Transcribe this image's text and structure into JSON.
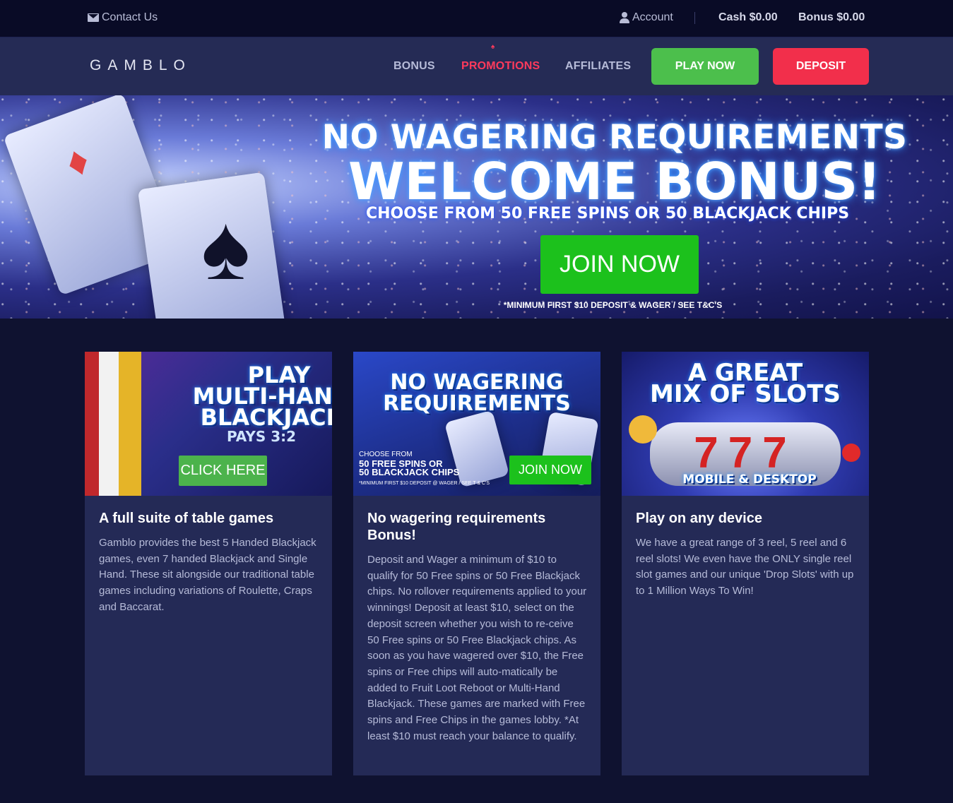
{
  "topbar": {
    "contact": "Contact Us",
    "account": "Account",
    "cash": "Cash $0.00",
    "bonus": "Bonus $0.00"
  },
  "header": {
    "logo": "GAMBLO",
    "nav": [
      "BONUS",
      "PROMOTIONS",
      "AFFILIATES"
    ],
    "active_nav": "PROMOTIONS",
    "play_now": "PLAY NOW",
    "deposit": "DEPOSIT"
  },
  "hero": {
    "line1": "NO WAGERING REQUIREMENTS",
    "line2": "WELCOME BONUS!",
    "line3": "CHOOSE FROM 50 FREE SPINS OR 50 BLACKJACK CHIPS",
    "button": "JOIN NOW",
    "terms": "*MINIMUM FIRST $10 DEPOSIT & WAGER / SEE T&C'S"
  },
  "cards": [
    {
      "img_line1": "PLAY",
      "img_line2": "MULTI-HAND",
      "img_line3": "BLACKJACK",
      "img_sub": "PAYS 3:2",
      "img_button": "CLICK HERE",
      "title": "A full suite of table games",
      "text": "Gamblo provides the best 5 Handed Blackjack games, even 7 handed Blackjack and Single Hand. These sit alongside our traditional table games including variations of Roulette, Craps and Baccarat."
    },
    {
      "img_line1": "NO WAGERING",
      "img_line2": "REQUIREMENTS",
      "img_choose": "CHOOSE FROM",
      "img_offer1": "50 FREE SPINS OR",
      "img_offer2": "50 BLACKJACK CHIPS",
      "img_terms": "*MINIMUM FIRST $10 DEPOSIT @ WAGER / SEE T & C'S",
      "img_button": "JOIN NOW",
      "title": "No wagering requirements Bonus!",
      "text": "Deposit and Wager a minimum of $10 to qualify for 50 Free spins or 50 Free Blackjack chips. No rollover requirements applied to your winnings! Deposit at least $10, select on the deposit screen whether you wish to re-ceive 50 Free spins or 50 Free Blackjack chips. As soon as you have wagered over $10, the Free spins or Free chips will auto-matically be added to Fruit Loot Reboot or Multi-Hand Blackjack. These games are marked with Free spins and Free Chips in the games lobby. *At least $10 must reach your balance to qualify."
    },
    {
      "img_line1": "A GREAT",
      "img_line2": "MIX OF SLOTS",
      "img_sub": "MOBILE & DESKTOP",
      "title": "Play on any device",
      "text": "We have a great range of 3 reel, 5 reel and 6 reel slots! We even have the ONLY single reel slot games and our unique 'Drop Slots' with up to 1 Million Ways To Win!"
    }
  ],
  "colors": {
    "topbar_bg": "#090b26",
    "header_bg": "#252b55",
    "active_nav": "#ff3a5c",
    "play_btn": "#4cbf4c",
    "deposit_btn": "#f22f4b",
    "card_bg": "#242a56",
    "join_green": "#1cc11c"
  }
}
